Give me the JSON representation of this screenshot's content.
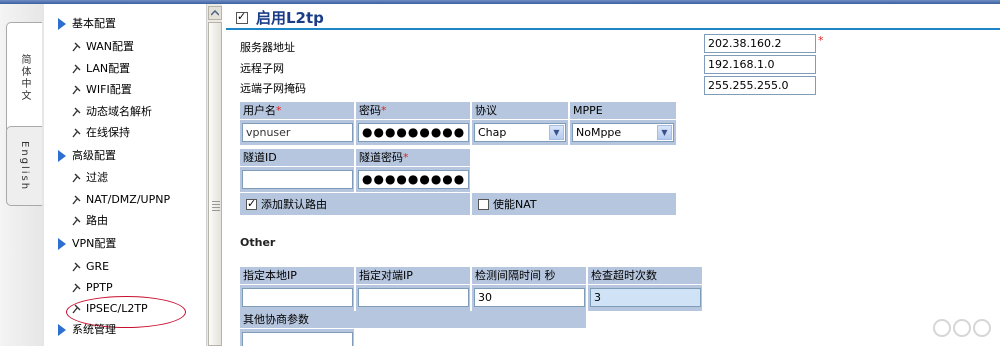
{
  "lang_tabs": {
    "chinese": "简体中文",
    "english": "English"
  },
  "nav": {
    "basic": "基本配置",
    "wan": "WAN配置",
    "lan": "LAN配置",
    "wifi": "WIFI配置",
    "ddns": "动态域名解析",
    "keepalive": "在线保持",
    "advanced": "高级配置",
    "filter": "过滤",
    "nat": "NAT/DMZ/UPNP",
    "route": "路由",
    "vpn": "VPN配置",
    "gre": "GRE",
    "pptp": "PPTP",
    "ipsec": "IPSEC/L2TP",
    "system": "系统管理"
  },
  "main": {
    "title": "启用L2tp",
    "server_label": "服务器地址",
    "server_value": "202.38.160.2",
    "subnet_label": "远程子网",
    "subnet_value": "192.168.1.0",
    "mask_label": "远端子网掩码",
    "mask_value": "255.255.255.0",
    "username_header": "用户名",
    "password_header": "密码",
    "protocol_header": "协议",
    "mppe_header": "MPPE",
    "username_value": "vpnuser",
    "password_value": "●●●●●●●●●",
    "protocol_value": "Chap",
    "mppe_value": "NoMppe",
    "tunnel_id_header": "隧道ID",
    "tunnel_pw_header": "隧道密码",
    "tunnel_id_value": "",
    "tunnel_pw_value": "●●●●●●●●●",
    "default_route_label": "添加默认路由",
    "nat_label": "使能NAT",
    "other_label": "Other",
    "local_ip_header": "指定本地IP",
    "remote_ip_header": "指定对端IP",
    "interval_header": "检测间隔时间 秒",
    "timeout_header": "检查超时次数",
    "local_ip_value": "",
    "remote_ip_value": "",
    "interval_value": "30",
    "timeout_value": "3",
    "other_params_header": "其他协商参数",
    "other_params_value": "",
    "required_mark": "*"
  },
  "colors": {
    "accent": "#1e84c8",
    "title": "#1b3d87",
    "header_bg": "#b6c6de",
    "required": "#d9241f",
    "highlight": "#c8102e"
  }
}
